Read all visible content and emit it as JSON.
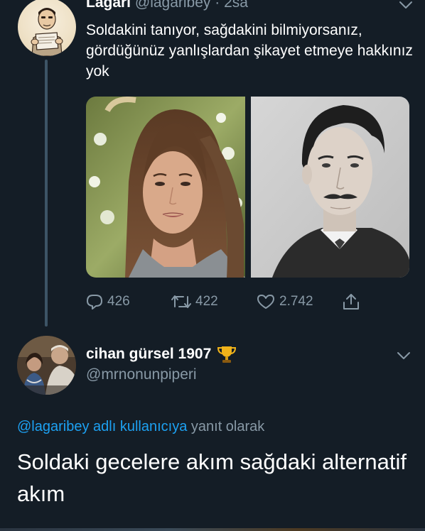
{
  "tweet1": {
    "author_name": "Lagarı",
    "author_handle": "@lagaribey · 2sa",
    "text": "Soldakini tanıyor, sağdakini bilmiyorsanız, gördüğünüz yanlışlardan şikayet etmeye hakkınız yok",
    "reply_count": "426",
    "retweet_count": "422",
    "like_count": "2.742",
    "icons": [
      "avatar",
      "chevron-down-icon",
      "reply-icon",
      "retweet-icon",
      "heart-icon",
      "share-icon"
    ]
  },
  "tweet2": {
    "author_name": "cihan gürsel 1907",
    "author_handle": "@mrnonunpiperi",
    "reply_to_link": "@lagaribey adlı kullanıcıya",
    "reply_to_suffix": " yanıt olarak",
    "text": "Soldaki gecelere akım sağdaki alternatif akım",
    "icons": [
      "avatar",
      "trophy-icon",
      "chevron-down-icon"
    ]
  },
  "colors": {
    "background": "#141d26",
    "text": "#ffffff",
    "secondary_text": "#8899a6",
    "link": "#1da1f2",
    "thread_line": "#3d5466"
  }
}
